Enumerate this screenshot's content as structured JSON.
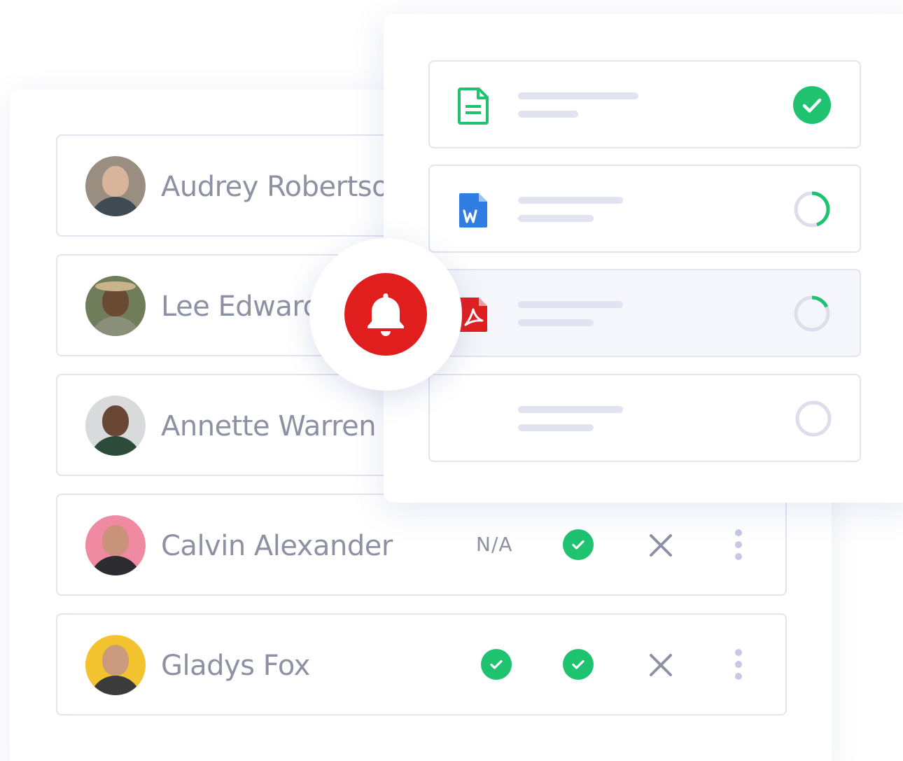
{
  "people": [
    {
      "name": "Audrey Robertson",
      "avatar": {
        "bg": "#9a8e80",
        "skin": "#d8b59a",
        "shirt": "#3f4a52"
      },
      "cols": []
    },
    {
      "name": "Lee Edwards",
      "avatar": {
        "bg": "#6f7d5a",
        "skin": "#6b4a33",
        "shirt": "#8a8f7a"
      },
      "cols": []
    },
    {
      "name": "Annette Warren",
      "avatar": {
        "bg": "#d9dadb",
        "skin": "#6a4634",
        "shirt": "#2d4b3b"
      },
      "cols": []
    },
    {
      "name": "Calvin Alexander",
      "avatar": {
        "bg": "#f08aa2",
        "skin": "#c9927a",
        "shirt": "#2b2b30"
      },
      "na_label": "N/A"
    },
    {
      "name": "Gladys Fox",
      "avatar": {
        "bg": "#f2c32f",
        "skin": "#c99a7c",
        "shirt": "#3b3b3b"
      }
    }
  ],
  "status_icons": {
    "approved": "check-circle-icon",
    "rejected": "x-icon",
    "menu": "more-vertical-icon"
  },
  "documents": [
    {
      "type": "doc-icon",
      "status": "complete",
      "progress": 1.0,
      "color": "#1ec26f"
    },
    {
      "type": "word-icon",
      "status": "in-progress",
      "progress": 0.45,
      "color": "#2f7de1"
    },
    {
      "type": "pdf-icon",
      "status": "in-progress",
      "progress": 0.18,
      "color": "#e01e1e"
    },
    {
      "type": "none",
      "status": "pending",
      "progress": 0.0
    }
  ],
  "notification": {
    "icon": "bell-icon",
    "color": "#e01e1e"
  },
  "colors": {
    "green": "#1ec26f",
    "text": "#8c92a3",
    "border": "#e3e4f0",
    "skeleton": "#e2e3f1",
    "ring": "#dcdeec"
  }
}
